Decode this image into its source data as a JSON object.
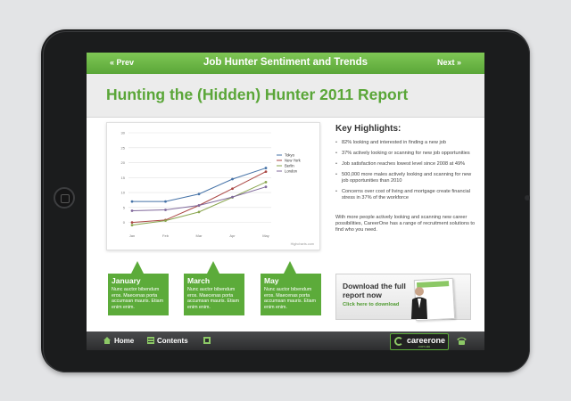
{
  "nav": {
    "prev_label": "« Prev",
    "title": "Job Hunter Sentiment and Trends",
    "next_label": "Next »"
  },
  "header": {
    "title": "Hunting the (Hidden) Hunter 2011 Report"
  },
  "highlights": {
    "title": "Key Highlights:",
    "items": [
      "82% looking and interested in finding a new job",
      "37% actively looking or scanning for new job opportunities",
      "Job satisfaction reaches lowest level since 2008 at 49%",
      "500,000 more males actively looking and scanning for new job opportunities than 2010",
      "Concerns over cost of living and mortgage create financial stress in 37% of the workforce"
    ],
    "outro": "With more people actively looking and scanning new career possibilities, CareerOne has a range of recruitment solutions to find who you need."
  },
  "months": [
    {
      "title": "January",
      "text": "Nunc auctor bibendum eros. Maecenas porta accumsan mauris. Etiam enim enim."
    },
    {
      "title": "March",
      "text": "Nunc auctor bibendum eros. Maecenas porta accumsan mauris. Etiam enim enim."
    },
    {
      "title": "May",
      "text": "Nunc auctor bibendum eros. Maecenas porta accumsan mauris. Etiam enim enim."
    }
  ],
  "download": {
    "title": "Download the full report now",
    "link": "Click here to download"
  },
  "footer": {
    "home_label": "Home",
    "contents_label": "Contents",
    "logo_text": "careerone",
    "logo_sub": ".com.au"
  },
  "colors": {
    "accent": "#5aa638",
    "footer": "#333333"
  },
  "icons": {
    "home": "home-icon",
    "contents": "contents-icon",
    "bookmark": "bookmark-icon",
    "phone": "phone-icon"
  },
  "chart_data": {
    "type": "line",
    "x": [
      "Jan",
      "Feb",
      "Mar",
      "Apr",
      "May"
    ],
    "series": [
      {
        "name": "Tokyo",
        "color": "#4572a7",
        "values": [
          7,
          7,
          9.5,
          14.5,
          18.2
        ]
      },
      {
        "name": "New York",
        "color": "#aa4643",
        "values": [
          0,
          0.8,
          5.7,
          11.3,
          17
        ]
      },
      {
        "name": "Berlin",
        "color": "#89a54e",
        "values": [
          -0.9,
          0.6,
          3.5,
          8.4,
          13.5
        ]
      },
      {
        "name": "London",
        "color": "#80699b",
        "values": [
          3.9,
          4.2,
          5.7,
          8.5,
          11.9
        ]
      }
    ],
    "yticks": [
      0,
      5,
      10,
      15,
      20,
      25,
      30
    ],
    "ylim": [
      -2.5,
      30
    ],
    "grid": true,
    "legend": "right",
    "credit": "Highcharts.com"
  }
}
